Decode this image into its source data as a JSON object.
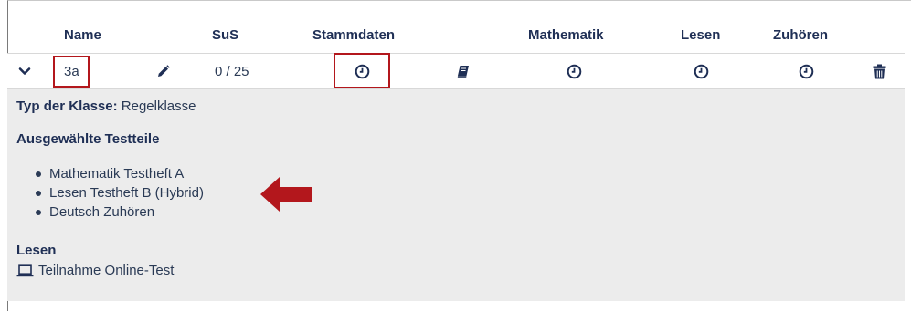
{
  "header": {
    "name": "Name",
    "sus": "SuS",
    "stammdaten": "Stammdaten",
    "mathematik": "Mathematik",
    "lesen": "Lesen",
    "zuhoeren": "Zuhören"
  },
  "row": {
    "class_name": "3a",
    "sus_count": "0 / 25",
    "icons": {
      "expand": "chevron-down-icon",
      "edit": "pencil-icon",
      "stammdaten": "clock-icon",
      "book": "book-icon",
      "mathematik": "clock-icon",
      "lesen": "clock-icon",
      "zuhoeren": "clock-icon",
      "delete": "trash-icon"
    }
  },
  "details": {
    "type_label": "Typ der Klasse:",
    "type_value": "Regelklasse",
    "tests_heading": "Ausgewählte Testteile",
    "tests": [
      "Mathematik Testheft A",
      "Lesen Testheft B (Hybrid)",
      "Deutsch Zuhören"
    ],
    "lesen_heading": "Lesen",
    "lesen_mode": "Teilnahme Online-Test",
    "lesen_mode_icon": "laptop-icon"
  },
  "colors": {
    "highlight": "#b3171c",
    "header_text": "#1f2f55",
    "details_bg": "#ececec"
  }
}
